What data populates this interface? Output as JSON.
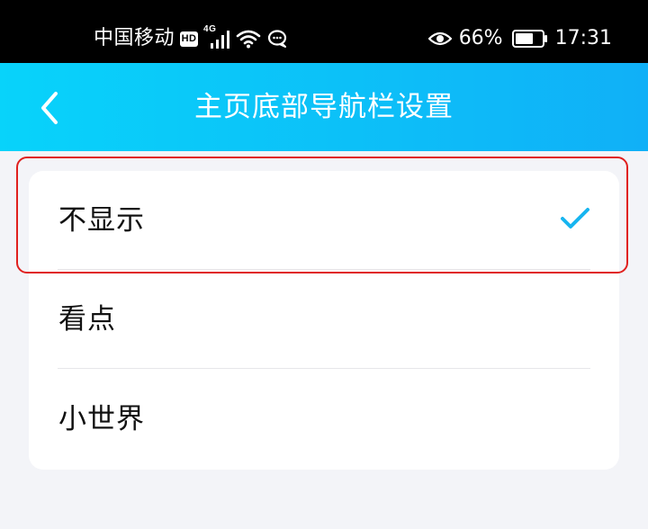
{
  "status_bar": {
    "carrier": "中国移动",
    "hd_badge": "HD",
    "network_type": "4G",
    "battery_percent": "66%",
    "time": "17:31",
    "icons": [
      "hd-icon",
      "signal-icon",
      "wifi-icon",
      "chat-bubble-icon",
      "eye-icon",
      "battery-icon"
    ]
  },
  "header": {
    "title": "主页底部导航栏设置",
    "back_icon": "chevron-left-icon"
  },
  "options": [
    {
      "label": "不显示",
      "selected": true
    },
    {
      "label": "看点",
      "selected": false
    },
    {
      "label": "小世界",
      "selected": false
    }
  ],
  "colors": {
    "header_gradient_start": "#08d3fa",
    "header_gradient_end": "#10b0f7",
    "check_color": "#17b5f0",
    "highlight_border": "#e0201e",
    "page_background": "#f3f4f8"
  }
}
